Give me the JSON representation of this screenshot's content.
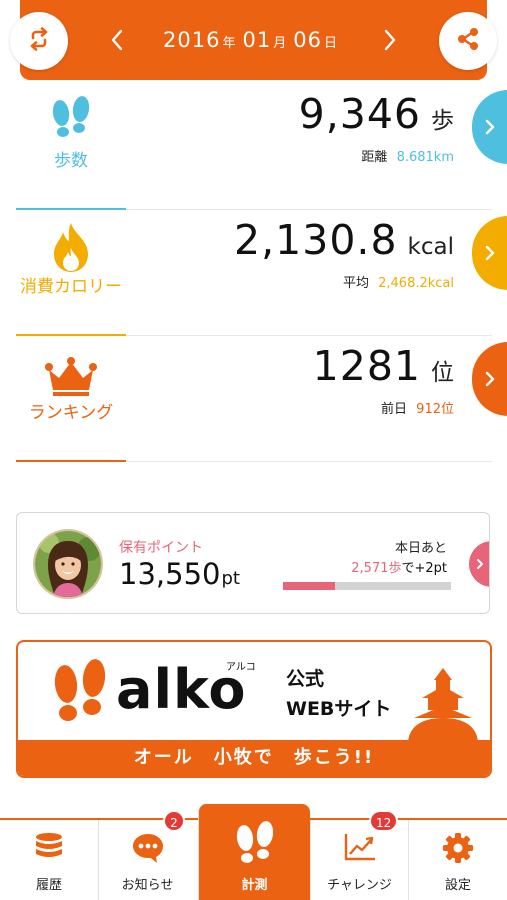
{
  "colors": {
    "brand_orange": "#ea6212",
    "steps_blue": "#4fbfe0",
    "calorie_yellow": "#f2ad00",
    "points_pink": "#e86579"
  },
  "header": {
    "date": {
      "year": "2016",
      "year_unit": "年",
      "month": "01",
      "month_unit": "月",
      "day": "06",
      "day_unit": "日"
    },
    "icons": {
      "back": "return-arrow-icon",
      "prev": "chevron-left-icon",
      "next": "chevron-right-icon",
      "share": "share-icon"
    }
  },
  "stats": {
    "steps": {
      "label": "歩数",
      "value": "9,346",
      "unit": "歩",
      "sub_label": "距離",
      "sub_value": "8.681km",
      "icon": "footprints-icon"
    },
    "calories": {
      "label": "消費カロリー",
      "value": "2,130.8",
      "unit": "kcal",
      "sub_label": "平均",
      "sub_value": "2,468.2kcal",
      "icon": "flame-icon"
    },
    "ranking": {
      "label": "ランキング",
      "value": "1281",
      "unit": "位",
      "sub_label": "前日",
      "sub_value": "912位",
      "icon": "crown-icon"
    }
  },
  "points": {
    "label": "保有ポイント",
    "value": "13,550",
    "unit": "pt",
    "today_label": "本日あと",
    "remaining_steps": "2,571歩",
    "reward_text": "で+2pt",
    "progress": 0.31
  },
  "banner": {
    "logo": "alko",
    "ruby": "アルコ",
    "line1": "公式",
    "line2": "WEBサイト",
    "slogan": "オール　小牧で　歩こう!!"
  },
  "tabs": [
    {
      "label": "履歴",
      "icon": "database-icon",
      "badge": ""
    },
    {
      "label": "お知らせ",
      "icon": "chat-bubble-icon",
      "badge": "2"
    },
    {
      "label": "計測",
      "icon": "footprints-icon",
      "badge": ""
    },
    {
      "label": "チャレンジ",
      "icon": "trend-chart-icon",
      "badge": "12"
    },
    {
      "label": "設定",
      "icon": "gear-icon",
      "badge": ""
    }
  ]
}
